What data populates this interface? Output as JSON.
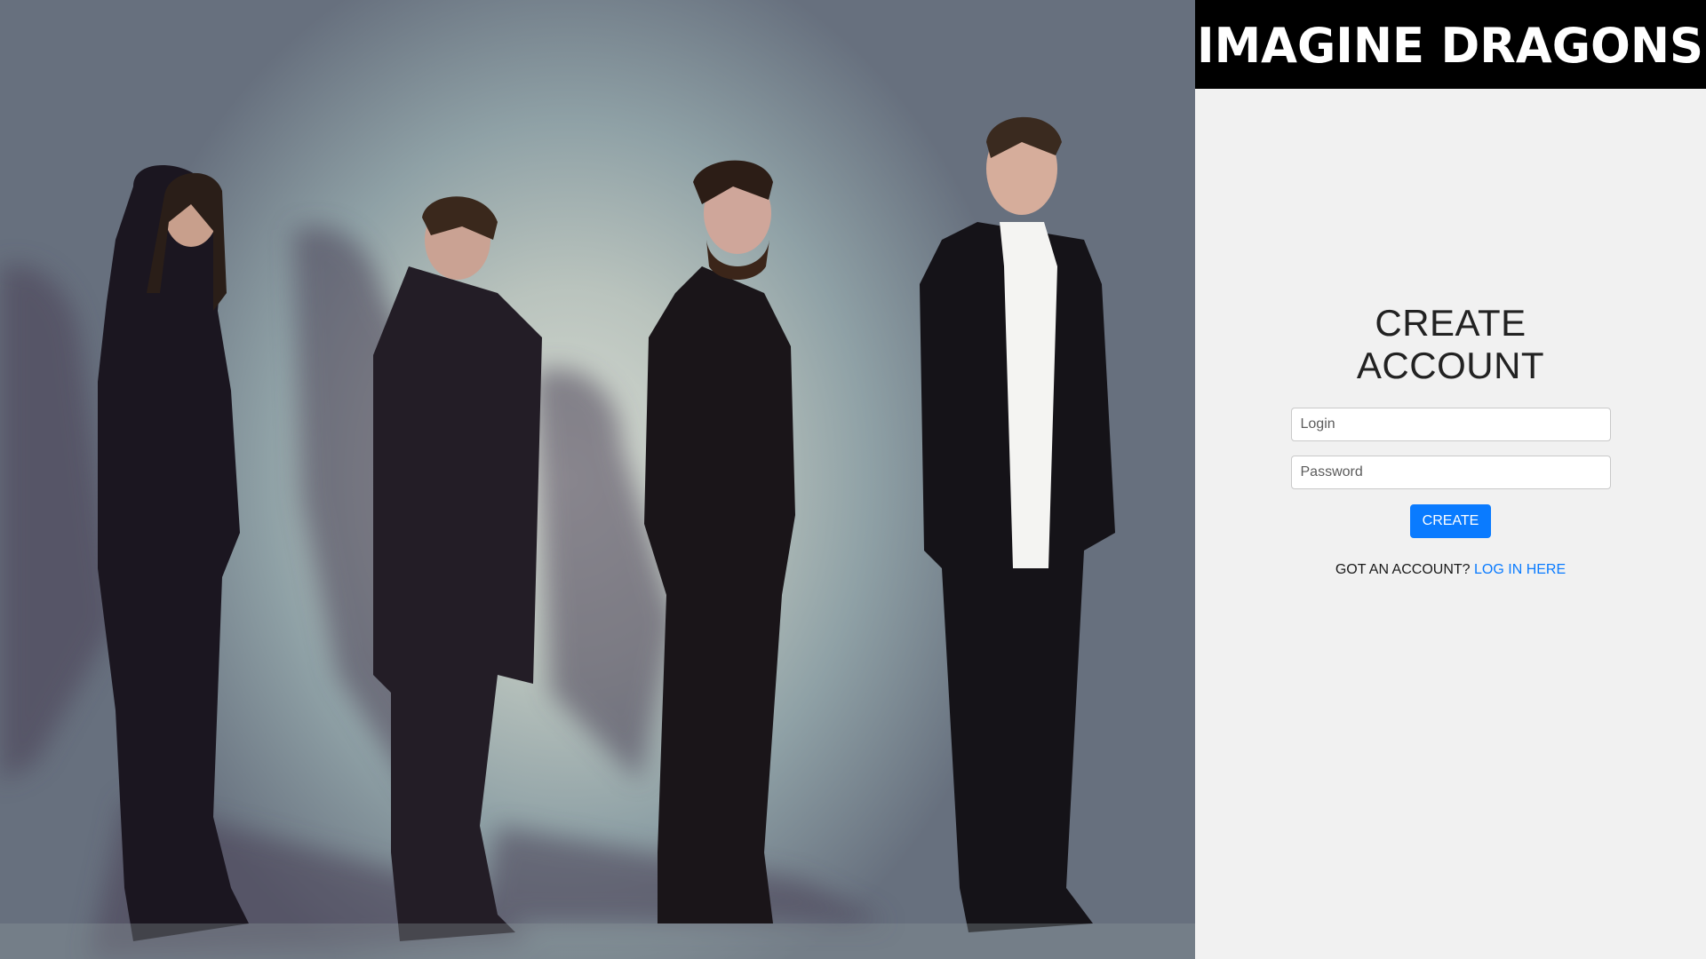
{
  "brand": {
    "logo_text": "IMAGINE DRAGONS"
  },
  "form": {
    "title_line1": "CREATE",
    "title_line2": "ACCOUNT",
    "login_placeholder": "Login",
    "password_placeholder": "Password",
    "submit_label": "CREATE",
    "account_prompt": "GOT AN ACCOUNT?",
    "login_link_label": "LOG IN HERE"
  },
  "colors": {
    "accent": "#0a7bff",
    "panel_background": "#f1f1f1",
    "logo_background": "#000000"
  }
}
